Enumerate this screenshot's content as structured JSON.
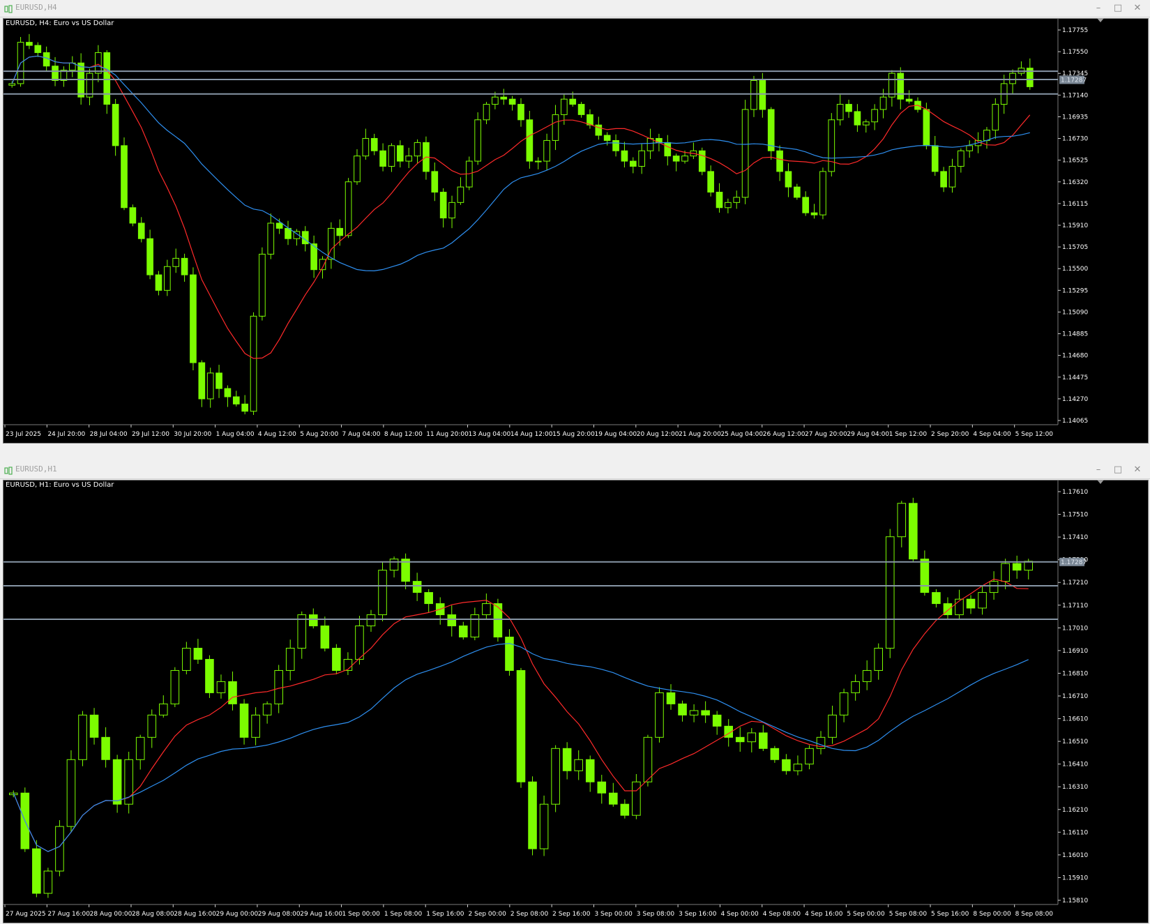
{
  "colors": {
    "candle": "#7CFC00",
    "ma_fast": "#ff2a2a",
    "ma_slow": "#2e8ff0",
    "level_line": "#8796a6",
    "axis_text": "#ffffff",
    "bid_label_bg": "#7a8795",
    "background": "#000000"
  },
  "windows": [
    {
      "title": "EURUSD,H4",
      "chart_title": "EURUSD, H4:  Euro vs US Dollar",
      "icon": "chart-icon",
      "controls": [
        "minimize-icon",
        "maximize-icon",
        "close-icon"
      ]
    },
    {
      "title": "EURUSD,H1",
      "chart_title": "EURUSD, H1:  Euro vs US Dollar",
      "icon": "chart-icon",
      "controls": [
        "minimize-icon",
        "maximize-icon",
        "close-icon"
      ]
    }
  ],
  "chart_data": [
    {
      "type": "candlestick",
      "symbol": "EURUSD",
      "timeframe": "H4",
      "title": "EURUSD, H4:  Euro vs US Dollar",
      "ylim": [
        1.1395,
        1.1785
      ],
      "y_ticks": [
        "1.17755",
        "1.17550",
        "1.17345",
        "1.17140",
        "1.16935",
        "1.16730",
        "1.16525",
        "1.16320",
        "1.16115",
        "1.15910",
        "1.15705",
        "1.15500",
        "1.15295",
        "1.15090",
        "1.14885",
        "1.14680",
        "1.14475",
        "1.14270",
        "1.14065"
      ],
      "current_price": "1.17287",
      "x_ticks": [
        "23 Jul 2025",
        "24 Jul 20:00",
        "28 Jul 04:00",
        "29 Jul 12:00",
        "30 Jul 20:00",
        "1 Aug 04:00",
        "4 Aug 12:00",
        "5 Aug 20:00",
        "7 Aug 04:00",
        "8 Aug 12:00",
        "11 Aug 20:00",
        "13 Aug 04:00",
        "14 Aug 12:00",
        "15 Aug 20:00",
        "19 Aug 04:00",
        "20 Aug 12:00",
        "21 Aug 20:00",
        "25 Aug 04:00",
        "26 Aug 12:00",
        "27 Aug 20:00",
        "29 Aug 04:00",
        "1 Sep 12:00",
        "2 Sep 20:00",
        "4 Sep 04:00",
        "5 Sep 12:00"
      ],
      "horizontal_levels": [
        1.1737,
        1.1729,
        1.1715
      ],
      "close_series": [
        1.1725,
        1.1765,
        1.1762,
        1.1755,
        1.1742,
        1.1728,
        1.1738,
        1.1745,
        1.1712,
        1.1735,
        1.1755,
        1.1705,
        1.1665,
        1.1605,
        1.159,
        1.1575,
        1.154,
        1.1525,
        1.1548,
        1.1556,
        1.154,
        1.1455,
        1.142,
        1.1445,
        1.143,
        1.1422,
        1.1415,
        1.1408,
        1.15,
        1.156,
        1.159,
        1.1585,
        1.1575,
        1.1582,
        1.157,
        1.1545,
        1.1555,
        1.1585,
        1.1578,
        1.163,
        1.1655,
        1.1672,
        1.166,
        1.1645,
        1.1665,
        1.165,
        1.1655,
        1.1668,
        1.164,
        1.162,
        1.1595,
        1.161,
        1.1625,
        1.165,
        1.169,
        1.1705,
        1.1712,
        1.171,
        1.1705,
        1.169,
        1.165,
        1.165,
        1.167,
        1.1695,
        1.171,
        1.1705,
        1.1695,
        1.1685,
        1.1675,
        1.167,
        1.166,
        1.165,
        1.1645,
        1.166,
        1.1672,
        1.1668,
        1.1655,
        1.165,
        1.1655,
        1.166,
        1.164,
        1.162,
        1.1605,
        1.161,
        1.1615,
        1.17,
        1.1728,
        1.17,
        1.166,
        1.164,
        1.1625,
        1.1615,
        1.16,
        1.1598,
        1.164,
        1.169,
        1.1705,
        1.1698,
        1.1685,
        1.1688,
        1.17,
        1.1712,
        1.1735,
        1.171,
        1.1708,
        1.17,
        1.1665,
        1.164,
        1.1625,
        1.1645,
        1.166,
        1.1665,
        1.167,
        1.168,
        1.1705,
        1.1725,
        1.1735,
        1.174,
        1.1722
      ]
    },
    {
      "type": "candlestick",
      "symbol": "EURUSD",
      "timeframe": "H1",
      "title": "EURUSD, H1:  Euro vs US Dollar",
      "ylim": [
        1.1575,
        1.1764
      ],
      "y_ticks": [
        "1.17610",
        "1.17510",
        "1.17410",
        "1.17310",
        "1.17210",
        "1.17110",
        "1.17010",
        "1.16910",
        "1.16810",
        "1.16710",
        "1.16610",
        "1.16510",
        "1.16410",
        "1.16310",
        "1.16210",
        "1.16110",
        "1.16010",
        "1.15910",
        "1.15810"
      ],
      "current_price": "1.17287",
      "x_ticks": [
        "27 Aug 2025",
        "27 Aug 16:00",
        "28 Aug 00:00",
        "28 Aug 08:00",
        "28 Aug 16:00",
        "29 Aug 00:00",
        "29 Aug 08:00",
        "29 Aug 16:00",
        "1 Sep 00:00",
        "1 Sep 08:00",
        "1 Sep 16:00",
        "2 Sep 00:00",
        "2 Sep 08:00",
        "2 Sep 16:00",
        "3 Sep 00:00",
        "3 Sep 08:00",
        "3 Sep 16:00",
        "4 Sep 00:00",
        "4 Sep 08:00",
        "4 Sep 16:00",
        "5 Sep 00:00",
        "5 Sep 08:00",
        "5 Sep 16:00",
        "8 Sep 00:00",
        "8 Sep 08:00"
      ],
      "horizontal_levels": [
        1.17287,
        1.1718,
        1.1703
      ],
      "close_series": [
        1.1625,
        1.16,
        1.158,
        1.159,
        1.161,
        1.164,
        1.166,
        1.165,
        1.164,
        1.162,
        1.164,
        1.165,
        1.166,
        1.1665,
        1.168,
        1.169,
        1.1685,
        1.167,
        1.1675,
        1.1665,
        1.165,
        1.166,
        1.1665,
        1.168,
        1.169,
        1.1705,
        1.17,
        1.169,
        1.168,
        1.1685,
        1.17,
        1.1705,
        1.1725,
        1.173,
        1.172,
        1.1715,
        1.171,
        1.1705,
        1.17,
        1.1695,
        1.1705,
        1.171,
        1.1695,
        1.168,
        1.163,
        1.16,
        1.162,
        1.1645,
        1.1635,
        1.164,
        1.163,
        1.1625,
        1.162,
        1.1615,
        1.163,
        1.165,
        1.167,
        1.1665,
        1.166,
        1.1662,
        1.166,
        1.1655,
        1.165,
        1.1648,
        1.1652,
        1.1645,
        1.164,
        1.1635,
        1.1638,
        1.1645,
        1.165,
        1.166,
        1.167,
        1.1675,
        1.168,
        1.169,
        1.174,
        1.1755,
        1.173,
        1.1715,
        1.171,
        1.1705,
        1.1712,
        1.1708,
        1.1715,
        1.172,
        1.1728,
        1.1725,
        1.1729
      ]
    }
  ]
}
